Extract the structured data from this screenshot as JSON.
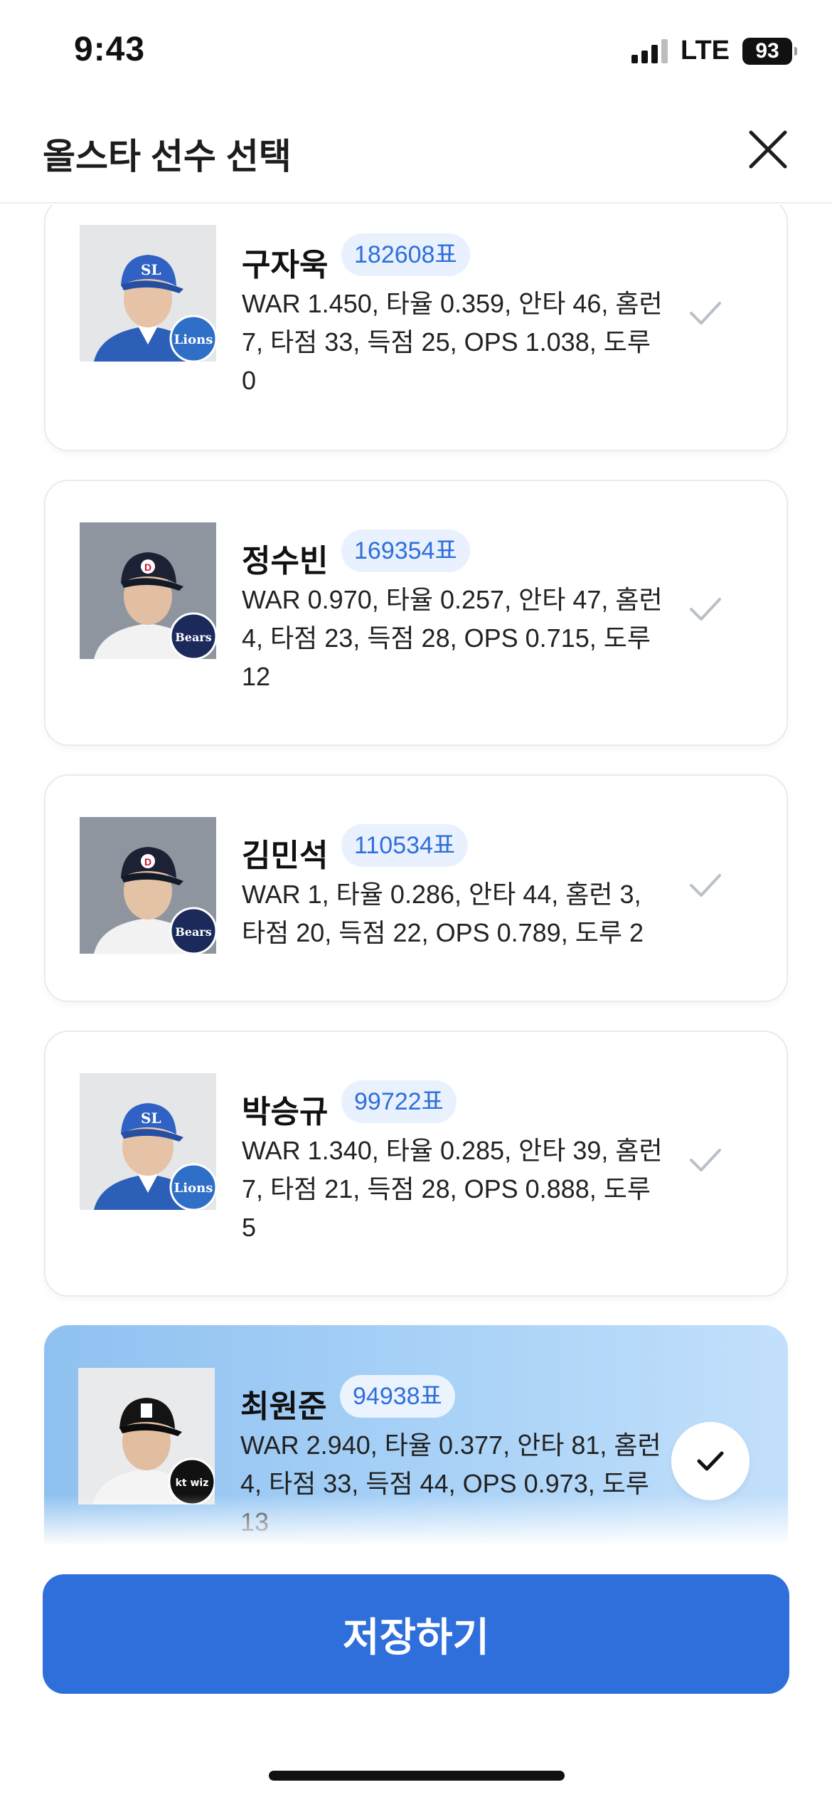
{
  "status_bar": {
    "time": "9:43",
    "network": "LTE",
    "battery": "93"
  },
  "header": {
    "title": "올스타 선수 선택",
    "close_icon": "close-icon"
  },
  "players": [
    {
      "name": "구자욱",
      "votes": "182608표",
      "stats": "WAR 1.450, 타율 0.359, 안타 46, 홈런 7, 타점 33, 득점 25, OPS 1.038, 도루 0",
      "team_logo": "Lions",
      "selected": false
    },
    {
      "name": "정수빈",
      "votes": "169354표",
      "stats": "WAR 0.970, 타율 0.257, 안타 47, 홈런 4, 타점 23, 득점 28, OPS 0.715, 도루 12",
      "team_logo": "Bears",
      "selected": false
    },
    {
      "name": "김민석",
      "votes": "110534표",
      "stats": "WAR 1, 타율 0.286, 안타 44, 홈런 3, 타점 20, 득점 22, OPS 0.789, 도루 2",
      "team_logo": "Bears",
      "selected": false
    },
    {
      "name": "박승규",
      "votes": "99722표",
      "stats": "WAR 1.340, 타율 0.285, 안타 39, 홈런 7, 타점 21, 득점 28, OPS 0.888, 도루 5",
      "team_logo": "Lions",
      "selected": false
    },
    {
      "name": "최원준",
      "votes": "94938표",
      "stats": "WAR 2.940, 타율 0.377, 안타 81, 홈런 4, 타점 33, 득점 44, OPS 0.973, 도루 13",
      "team_logo": "kt wiz",
      "selected": true
    }
  ],
  "save_button": {
    "label": "저장하기"
  },
  "colors": {
    "primary": "#2f6fdc",
    "badge_bg": "#e8f1fd",
    "selected_bg_start": "#8fc1f0",
    "selected_bg_end": "#c3e0fb",
    "check_inactive": "#b9c0c8"
  }
}
